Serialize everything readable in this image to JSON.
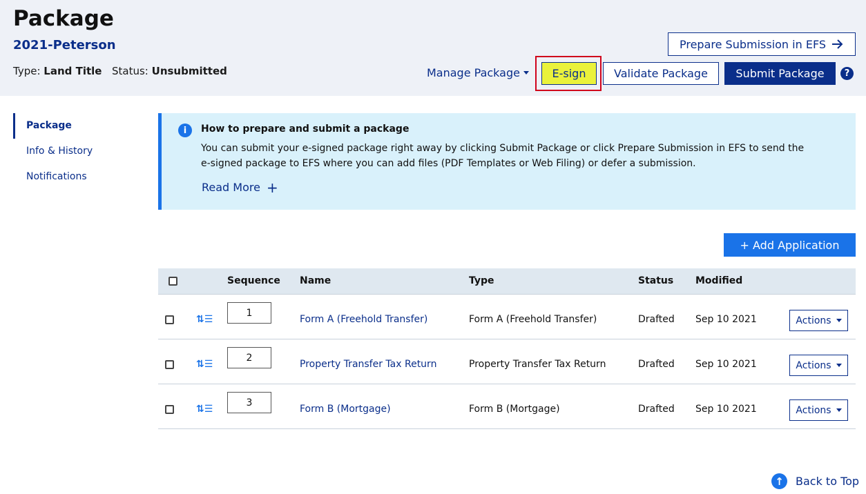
{
  "header": {
    "title": "Package",
    "subtitle": "2021-Peterson",
    "type_label": "Type:",
    "type_value": "Land Title",
    "status_label": "Status:",
    "status_value": "Unsubmitted",
    "prepare_label": "Prepare Submission in EFS",
    "prepare_icon": "arrow-right-icon",
    "manage_label": "Manage Package",
    "esign_label": "E-sign",
    "validate_label": "Validate Package",
    "submit_label": "Submit Package",
    "help_glyph": "?",
    "colors": {
      "primary": "#0a2e8a",
      "accent": "#1a73e8",
      "highlight": "#eaf23b",
      "highlight_border": "#d0021b",
      "header_bg": "#eef1f7"
    }
  },
  "sidebar": {
    "items": [
      {
        "label": "Package",
        "active": true
      },
      {
        "label": "Info & History",
        "active": false
      },
      {
        "label": "Notifications",
        "active": false
      }
    ]
  },
  "info": {
    "icon": "info-icon",
    "icon_glyph": "i",
    "title": "How to prepare and submit a package",
    "body_line1": "You can submit your e-signed package right away by clicking Submit Package or click Prepare Submission in EFS to send the",
    "body_line2": "e-signed package to EFS where you can add files (PDF Templates or Web Filing) or defer a submission.",
    "read_more": "Read More",
    "read_more_glyph": "+",
    "bg_color": "#d9f1fb"
  },
  "add_application_label": "+ Add Application",
  "table": {
    "columns": {
      "sequence": "Sequence",
      "name": "Name",
      "type": "Type",
      "status": "Status",
      "modified": "Modified"
    },
    "rows": [
      {
        "sequence": "1",
        "name": "Form A (Freehold Transfer)",
        "type": "Form A (Freehold Transfer)",
        "status": "Drafted",
        "modified": "Sep 10 2021",
        "actions": "Actions"
      },
      {
        "sequence": "2",
        "name": "Property Transfer Tax Return",
        "type": "Property Transfer Tax Return",
        "status": "Drafted",
        "modified": "Sep 10 2021",
        "actions": "Actions"
      },
      {
        "sequence": "3",
        "name": "Form B (Mortgage)",
        "type": "Form B (Mortgage)",
        "status": "Drafted",
        "modified": "Sep 10 2021",
        "actions": "Actions"
      }
    ]
  },
  "back_to_top": "Back to Top"
}
